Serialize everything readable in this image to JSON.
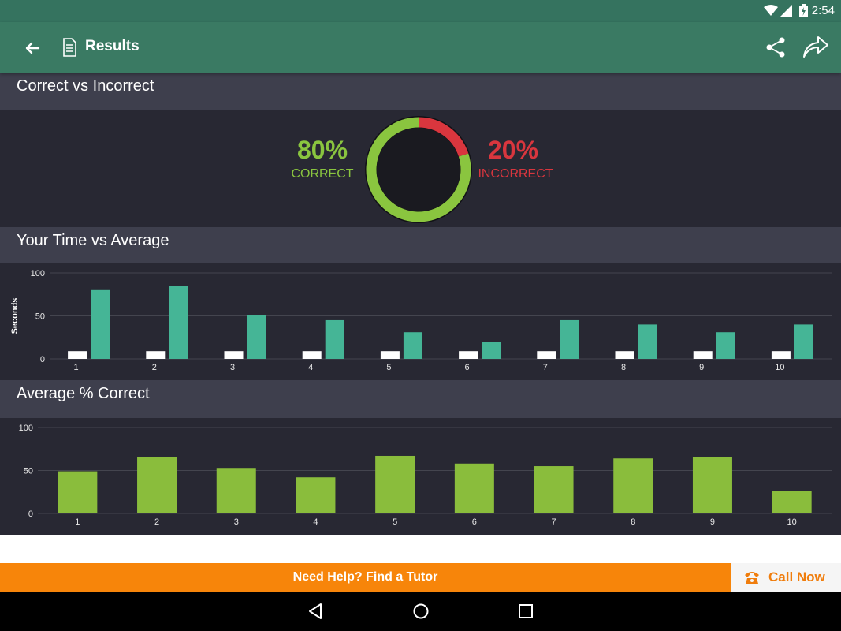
{
  "status": {
    "time": "2:54"
  },
  "app_bar": {
    "title": "Results"
  },
  "sections": {
    "correct": {
      "title": "Correct vs Incorrect"
    },
    "time": {
      "title": "Your Time vs Average"
    },
    "avg": {
      "title": "Average % Correct"
    }
  },
  "donut": {
    "correct_pct": "80%",
    "correct_label": "CORRECT",
    "incorrect_pct": "20%",
    "incorrect_label": "INCORRECT",
    "correct_fraction": 0.8,
    "correct_color": "#8ac53f",
    "incorrect_color": "#d9363e"
  },
  "footer": {
    "tutor_text": "Need Help? Find a Tutor",
    "call_label": "Call Now"
  },
  "colors": {
    "header_green": "#3a7a63",
    "accent_orange": "#f7850a",
    "time_bar": "#45b596",
    "avg_bar": "#8abd3c"
  },
  "chart_data": [
    {
      "type": "bar",
      "ylabel": "Seconds",
      "ylim": [
        0,
        100
      ],
      "yticks": [
        "100",
        "50",
        "0"
      ],
      "categories": [
        "1",
        "2",
        "3",
        "4",
        "5",
        "6",
        "7",
        "8",
        "9",
        "10"
      ],
      "series": [
        {
          "values": [
            9,
            9,
            9,
            9,
            9,
            9,
            9,
            9,
            9,
            9
          ],
          "color": "#ffffff"
        },
        {
          "values": [
            80,
            85,
            51,
            45,
            31,
            20,
            45,
            40,
            31,
            40
          ],
          "color": "#45b596"
        }
      ]
    },
    {
      "type": "bar",
      "ylim": [
        0,
        100
      ],
      "yticks": [
        "100",
        "50",
        "0"
      ],
      "categories": [
        "1",
        "2",
        "3",
        "4",
        "5",
        "6",
        "7",
        "8",
        "9",
        "10"
      ],
      "series": [
        {
          "values": [
            49,
            66,
            53,
            42,
            67,
            58,
            55,
            64,
            66,
            26
          ],
          "color": "#8abd3c"
        }
      ]
    }
  ]
}
